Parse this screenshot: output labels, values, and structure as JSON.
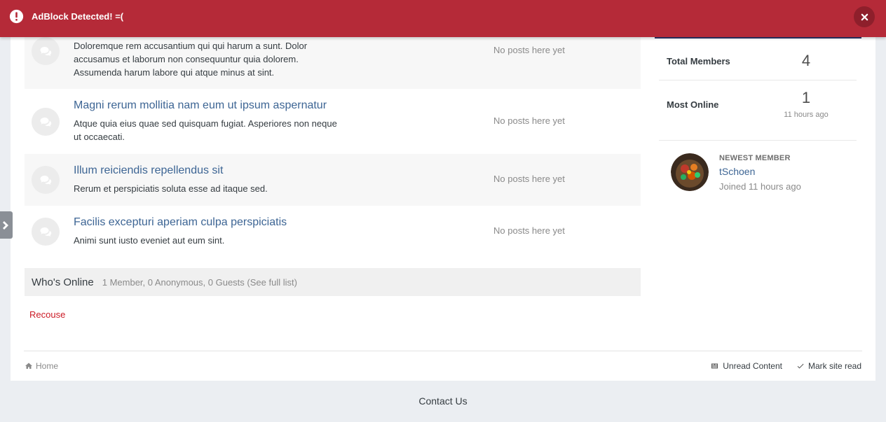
{
  "adblock": {
    "message": "AdBlock Detected! =(",
    "close_icon": "close-icon",
    "warning_icon": "exclamation-circle-icon",
    "color": "#b52a38"
  },
  "forums": [
    {
      "title": "",
      "description": "Doloremque rem accusantium qui qui harum a sunt. Dolor accusamus et laborum non consequuntur quia dolorem. Assumenda harum labore qui atque minus at sint.",
      "stat": "No posts here yet"
    },
    {
      "title": "Magni rerum mollitia nam eum ut ipsum aspernatur",
      "description": "Atque quia eius quae sed quisquam fugiat. Asperiores non neque ut occaecati.",
      "stat": "No posts here yet"
    },
    {
      "title": "Illum reiciendis repellendus sit",
      "description": "Rerum et perspiciatis soluta esse ad itaque sed.",
      "stat": "No posts here yet"
    },
    {
      "title": "Facilis excepturi aperiam culpa perspiciatis",
      "description": "Animi sunt iusto eveniet aut eum sint.",
      "stat": "No posts here yet"
    }
  ],
  "whos_online": {
    "title": "Who's Online",
    "summary": "1 Member, 0 Anonymous, 0 Guests",
    "link": "(See full list)"
  },
  "recouse_label": "Recouse",
  "stats": {
    "total_members_label": "Total Members",
    "total_members_value": "4",
    "most_online_label": "Most Online",
    "most_online_value": "1",
    "most_online_time": "11 hours ago"
  },
  "newest_member": {
    "kicker": "NEWEST MEMBER",
    "name": "tSchoen",
    "joined": "Joined 11 hours ago"
  },
  "footer": {
    "breadcrumb_home": "Home",
    "unread_content": "Unread Content",
    "mark_site_read": "Mark site read"
  },
  "contact_label": "Contact Us",
  "colors": {
    "link": "#3d6594",
    "accent": "#2e3366",
    "recouse": "#cc1a25"
  }
}
